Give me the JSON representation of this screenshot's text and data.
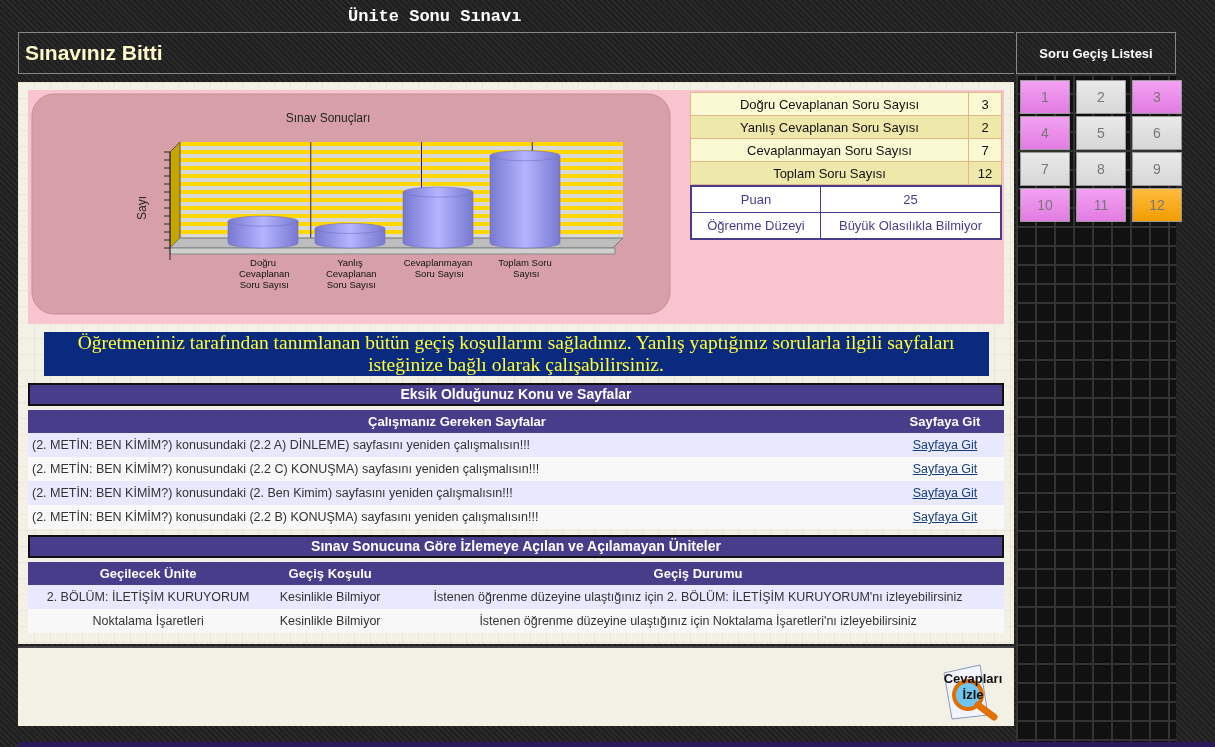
{
  "page_title": "Ünite Sonu Sınavı",
  "header": {
    "title": "Sınavınız Bitti"
  },
  "sidebar": {
    "title": "Soru Geçiş Listesi",
    "questions": [
      {
        "label": "1",
        "color": "#ee82ee"
      },
      {
        "label": "2",
        "color": "#e2e2e2"
      },
      {
        "label": "3",
        "color": "#ee82ee"
      },
      {
        "label": "4",
        "color": "#ee82ee"
      },
      {
        "label": "5",
        "color": "#e2e2e2"
      },
      {
        "label": "6",
        "color": "#e2e2e2"
      },
      {
        "label": "7",
        "color": "#e2e2e2"
      },
      {
        "label": "8",
        "color": "#e2e2e2"
      },
      {
        "label": "9",
        "color": "#e2e2e2"
      },
      {
        "label": "10",
        "color": "#ee82ee"
      },
      {
        "label": "11",
        "color": "#ee82ee"
      },
      {
        "label": "12",
        "color": "#ffa500"
      }
    ]
  },
  "results": {
    "chart": {
      "title": "Sınav Sonuçları",
      "axis_title": "Sayı",
      "categories": [
        "Doğru Cevaplanan Soru Sayısı",
        "Yanlış Cevaplanan Soru Sayısı",
        "Cevaplanmayan Soru Sayısı",
        "Toplam Soru Sayısı"
      ]
    },
    "stats": [
      {
        "label": "Doğru Cevaplanan Soru Sayısı",
        "value": "3"
      },
      {
        "label": "Yanlış Cevaplanan Soru Sayısı",
        "value": "2"
      },
      {
        "label": "Cevaplanmayan Soru Sayısı",
        "value": "7"
      },
      {
        "label": "Toplam Soru Sayısı",
        "value": "12"
      }
    ],
    "score": [
      {
        "label": "Puan",
        "value": "25"
      },
      {
        "label": "Öğrenme Düzeyi",
        "value": "Büyük Olasılıkla Bilmiyor"
      }
    ]
  },
  "message": "Öğretmeniniz tarafından tanımlanan bütün geçiş koşullarını sağladınız. Yanlış yaptığınız sorularla ilgili sayfaları isteğinize bağlı olarak çalışabilirsiniz.",
  "missing_pages": {
    "title": "Eksik Olduğunuz Konu ve Sayfalar",
    "columns": [
      "Çalışmanız Gereken Sayfalar",
      "Sayfaya Git"
    ],
    "rows": [
      {
        "text": "(2. METİN: BEN KİMİM?) konusundaki (2.2 A) DİNLEME) sayfasını yeniden çalışmalısın!!!",
        "link": "Sayfaya Git"
      },
      {
        "text": "(2. METİN: BEN KİMİM?) konusundaki (2.2 C) KONUŞMA) sayfasını yeniden çalışmalısın!!!",
        "link": "Sayfaya Git"
      },
      {
        "text": "(2. METİN: BEN KİMİM?) konusundaki (2. Ben Kimim) sayfasını yeniden çalışmalısın!!!",
        "link": "Sayfaya Git"
      },
      {
        "text": "(2. METİN: BEN KİMİM?) konusundaki (2.2 B) KONUŞMA) sayfasını yeniden çalışmalısın!!!",
        "link": "Sayfaya Git"
      }
    ]
  },
  "units": {
    "title": "Sınav Sonucuna Göre İzlemeye Açılan ve Açılamayan Üniteler",
    "columns": [
      "Geçilecek Ünite",
      "Geçiş Koşulu",
      "Geçiş Durumu"
    ],
    "rows": [
      {
        "unit": "2. BÖLÜM: İLETİŞİM KURUYORUM",
        "condition": "Kesinlikle Bilmiyor",
        "status": "İstenen öğrenme düzeyine ulaştığınız için 2. BÖLÜM: İLETİŞİM KURUYORUM'nı izleyebilirsiniz"
      },
      {
        "unit": "Noktalama İşaretleri",
        "condition": "Kesinlikle Bilmiyor",
        "status": "İstenen öğrenme düzeyine ulaştığınız için Noktalama İşaretleri'nı izleyebilirsiniz"
      }
    ]
  },
  "footer": {
    "button": "Cevapları İzle"
  }
}
